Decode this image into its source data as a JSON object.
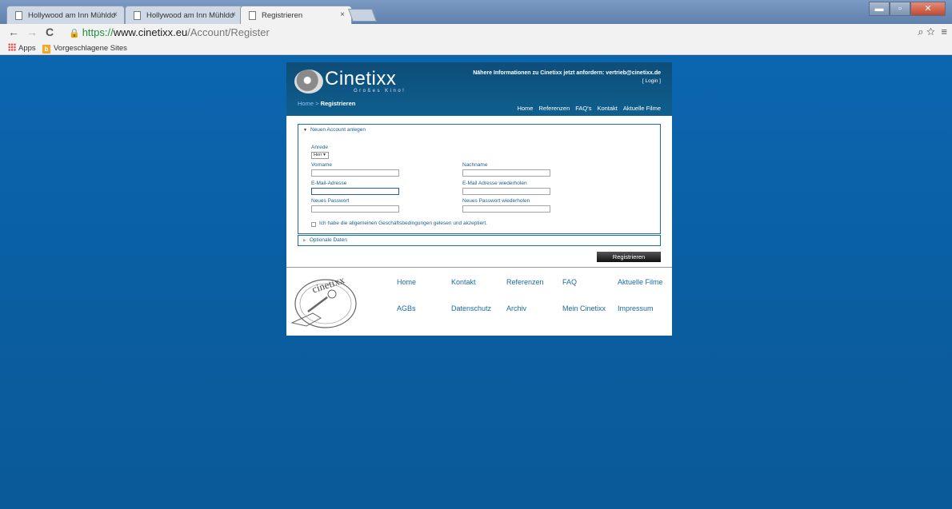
{
  "browser": {
    "tabs": [
      {
        "title": "Hollywood am Inn Mühldo",
        "close": "×"
      },
      {
        "title": "Hollywood am Inn Mühldo",
        "close": "×"
      },
      {
        "title": "Registrieren",
        "close": "×"
      }
    ],
    "window_buttons": {
      "minimize": "▬",
      "maximize": "▫",
      "close": "✕"
    },
    "nav": {
      "back": "←",
      "forward": "→",
      "reload": "C"
    },
    "url": {
      "scheme": "https://",
      "host": "www.cinetixx.eu",
      "path": "/Account/Register"
    },
    "toolbar_icons": {
      "zoom": "⌕",
      "star": "☆",
      "menu": "≡"
    },
    "bookmarks": [
      {
        "label": "Apps"
      },
      {
        "label": "Vorgeschlagene Sites"
      }
    ]
  },
  "header": {
    "logo_text": "Cinetixx",
    "logo_sub": "Großes Kino!",
    "info": "Nähere Informationen zu Cinetixx jetzt anfordern: vertrieb@cinetixx.de",
    "login": "[ Login ]",
    "breadcrumb_home": "Home",
    "breadcrumb_sep": " > ",
    "breadcrumb_current": "Registrieren",
    "nav": [
      "Home",
      "Referenzen",
      "FAQ's",
      "Kontakt",
      "Aktuelle Filme"
    ]
  },
  "form": {
    "section_title": "Neuen Account anlegen",
    "anrede_label": "Anrede",
    "anrede_value": "Herr",
    "vorname_label": "Vorname",
    "nachname_label": "Nachname",
    "email_label": "E-Mail-Adresse",
    "email_repeat_label": "E-Mail Adresse wiederholen",
    "password_label": "Neues Passwort",
    "password_repeat_label": "Neues Passwort wiederholen",
    "agb_label": "Ich habe die allgemeinen Geschäftsbedingungen gelesen und akzeptiert.",
    "optional_title": "Optionale Daten",
    "submit_label": "Registrieren"
  },
  "footer": {
    "logo_text": "cinetixx",
    "links": [
      "Home",
      "Kontakt",
      "Referenzen",
      "FAQ",
      "Aktuelle Filme",
      "AGBs",
      "Datenschutz",
      "Archiv",
      "Mein Cinetixx",
      "Impressum"
    ]
  },
  "colors": {
    "page_bg": "#0b5fa0",
    "header_bg": "#0f5a87",
    "link": "#1a6aa3"
  }
}
